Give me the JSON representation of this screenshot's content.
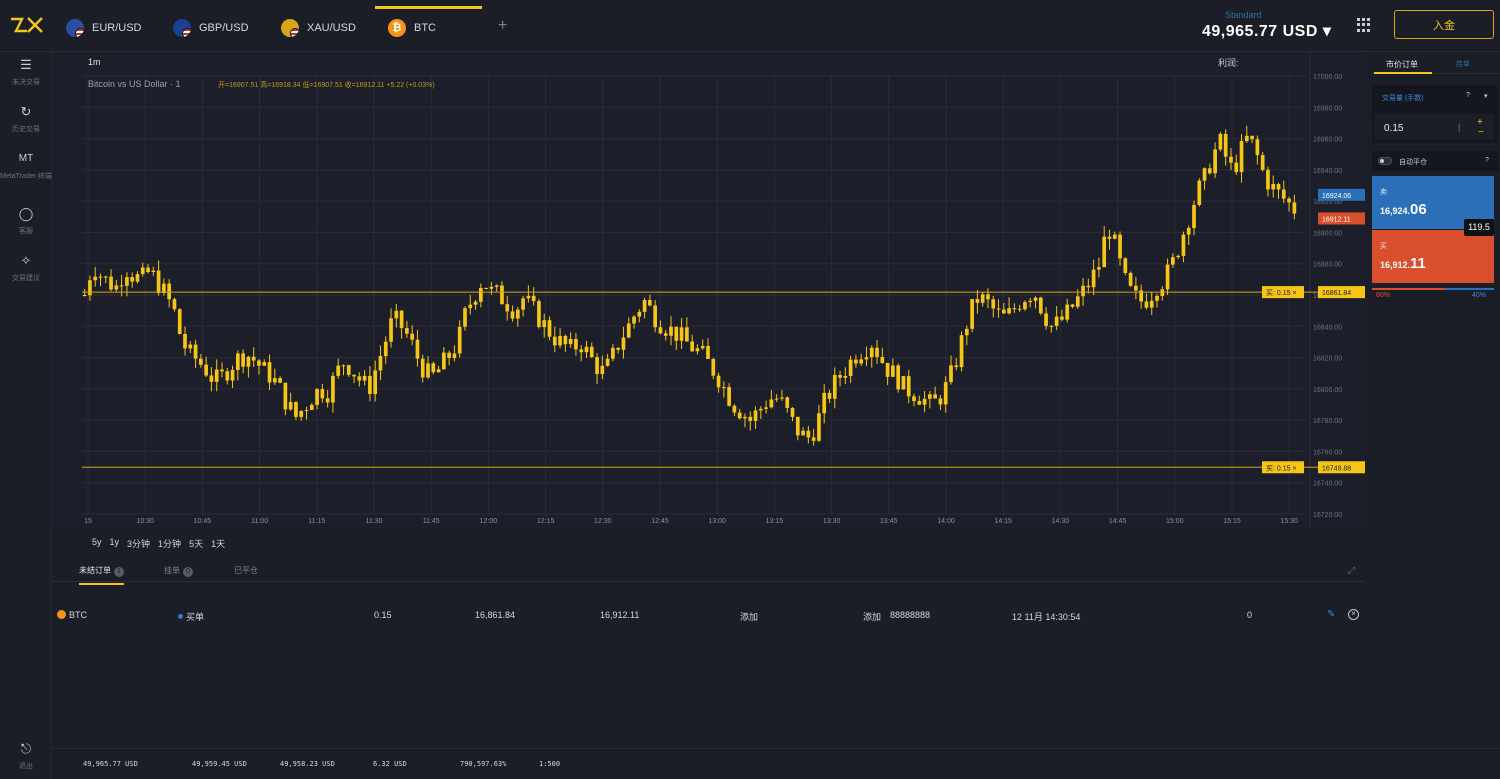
{
  "topbar": {
    "tabs": [
      {
        "label": "EUR/USD",
        "icon": "eur-usd-flag-icon"
      },
      {
        "label": "GBP/USD",
        "icon": "gbp-usd-flag-icon"
      },
      {
        "label": "XAU/USD",
        "icon": "xau-usd-flag-icon"
      },
      {
        "label": "BTC",
        "icon": "bitcoin-icon",
        "glyph": "₿"
      }
    ],
    "add_tab": "+",
    "account_type": "Standard",
    "balance": "49,965.77 USD ▾",
    "deposit_label": "入金"
  },
  "sidebar": {
    "items": [
      {
        "label": "未决交易",
        "icon": "list-icon",
        "glyph": "☰"
      },
      {
        "label": "历史交易",
        "icon": "history-icon",
        "glyph": "↻"
      },
      {
        "label": "MetaTrader 终端",
        "icon": "metatrader-icon",
        "glyph": "MT"
      },
      {
        "label": "客服",
        "icon": "chat-icon",
        "glyph": "◯"
      },
      {
        "label": "交易建议",
        "icon": "lightbulb-icon",
        "glyph": "✧"
      }
    ],
    "exit_label": "退出",
    "exit_icon": "exit-icon"
  },
  "chart": {
    "timeframe": "1m",
    "profit_label": "利润:",
    "title": "Bitcoin vs US Dollar · 1",
    "ohlc": "开=16907.51 高=16918.34 低=16907.51 收=16912.11 +5.22 (+0.03%)",
    "colors": {
      "up": "#f5c518",
      "down": "#f5c518",
      "grid": "#2a2d39",
      "order_line": "#d9a316",
      "ask": "#2a6fb8",
      "bid": "#d94f2e"
    }
  },
  "chart_data": {
    "type": "candlestick",
    "symbol": "Bitcoin vs US Dollar",
    "interval": "1m",
    "ylim": [
      16720,
      17000
    ],
    "y_ticks": [
      17000.0,
      16980.0,
      16960.0,
      16940.0,
      16920.0,
      16900.0,
      16880.0,
      16860.0,
      16840.0,
      16820.0,
      16800.0,
      16780.0,
      16760.0,
      16740.0,
      16720.0
    ],
    "x_ticks": [
      "15",
      "10:30",
      "10:45",
      "11:00",
      "11:15",
      "11:30",
      "11:45",
      "12:00",
      "12:15",
      "12:30",
      "12:45",
      "13:00",
      "13:15",
      "13:30",
      "13:45",
      "14:00",
      "14:15",
      "14:30",
      "14:45",
      "15:00",
      "15:15",
      "15:30"
    ],
    "close_path": [
      16860,
      16880,
      16872,
      16868,
      16865,
      16878,
      16872,
      16870,
      16875,
      16868,
      16860,
      16850,
      16830,
      16822,
      16818,
      16812,
      16805,
      16808,
      16815,
      16820,
      16822,
      16818,
      16812,
      16808,
      16800,
      16790,
      16782,
      16788,
      16795,
      16800,
      16798,
      16810,
      16818,
      16812,
      16805,
      16800,
      16815,
      16830,
      16845,
      16840,
      16832,
      16820,
      16810,
      16808,
      16815,
      16822,
      16830,
      16850,
      16860,
      16870,
      16862,
      16860,
      16855,
      16850,
      16858,
      16852,
      16845,
      16838,
      16832,
      16828,
      16825,
      16830,
      16822,
      16815,
      16810,
      16820,
      16832,
      16840,
      16850,
      16856,
      16848,
      16842,
      16838,
      16835,
      16830,
      16826,
      16822,
      16815,
      16808,
      16798,
      16790,
      16785,
      16780,
      16786,
      16792,
      16795,
      16790,
      16780,
      16772,
      16768,
      16775,
      16790,
      16800,
      16808,
      16815,
      16822,
      16826,
      16830,
      16820,
      16812,
      16808,
      16800,
      16798,
      16795,
      16790,
      16792,
      16800,
      16812,
      16830,
      16848,
      16858,
      16856,
      16850,
      16845,
      16848,
      16855,
      16860,
      16862,
      16850,
      16840,
      16842,
      16848,
      16855,
      16862,
      16870,
      16880,
      16905,
      16890,
      16870,
      16860,
      16856,
      16858,
      16866,
      16870,
      16880,
      16895,
      16910,
      16925,
      16935,
      16950,
      16958,
      16940,
      16945,
      16960,
      16955,
      16940,
      16930,
      16925,
      16920,
      16915
    ],
    "horizontal_lines": [
      {
        "price": 16861.84,
        "label": "16861.84",
        "tag": "买: 0.15"
      },
      {
        "price": 16749.88,
        "label": "16749.88",
        "tag": "买: 0.15"
      }
    ],
    "current_prices": {
      "ask": 16924.06,
      "ask_label": "16924.06",
      "bid": 16912.11,
      "bid_label": "16912.11"
    }
  },
  "periods": [
    "5y",
    "1y",
    "3分钟",
    "1分钟",
    "5天",
    "1天"
  ],
  "orders": {
    "tabs": [
      {
        "label": "未结订单",
        "count": "1",
        "active": true
      },
      {
        "label": "挂单",
        "count": "0",
        "active": false
      },
      {
        "label": "已平仓",
        "count": "",
        "active": false
      }
    ],
    "rows": [
      {
        "symbol": "BTC",
        "side": "买单",
        "volume": "0.15",
        "open_price": "16,861.84",
        "current_price": "16,912.11",
        "tp": "添加",
        "sl": "添加",
        "ticket": "88888888",
        "open_time": "12 11月 14:30:54",
        "pnl": "0"
      }
    ]
  },
  "footer": {
    "equity": "49,965.77 USD",
    "free_margin": "49,959.45 USD",
    "balance": "49,958.23 USD",
    "margin": "6.32 USD",
    "margin_level": "790,597.63%",
    "leverage": "1:500"
  },
  "trade_panel": {
    "tab_market": "市价订单",
    "tab_pending": "挂单",
    "mode": "交易量 (手数)",
    "mode_help": "?",
    "lot": "0.15",
    "plus": "+",
    "minus": "−",
    "auto_label": "自动平仓",
    "auto_help": "?",
    "sell_label": "卖",
    "sell_price_small": "16,924.",
    "sell_price_big": "06",
    "buy_label": "买",
    "buy_price_small": "16,912.",
    "buy_price_big": "11",
    "spread": "119.5",
    "sentiment_sell": "60%",
    "sentiment_buy": "40%",
    "sentiment_sell_fraction": 0.6
  }
}
